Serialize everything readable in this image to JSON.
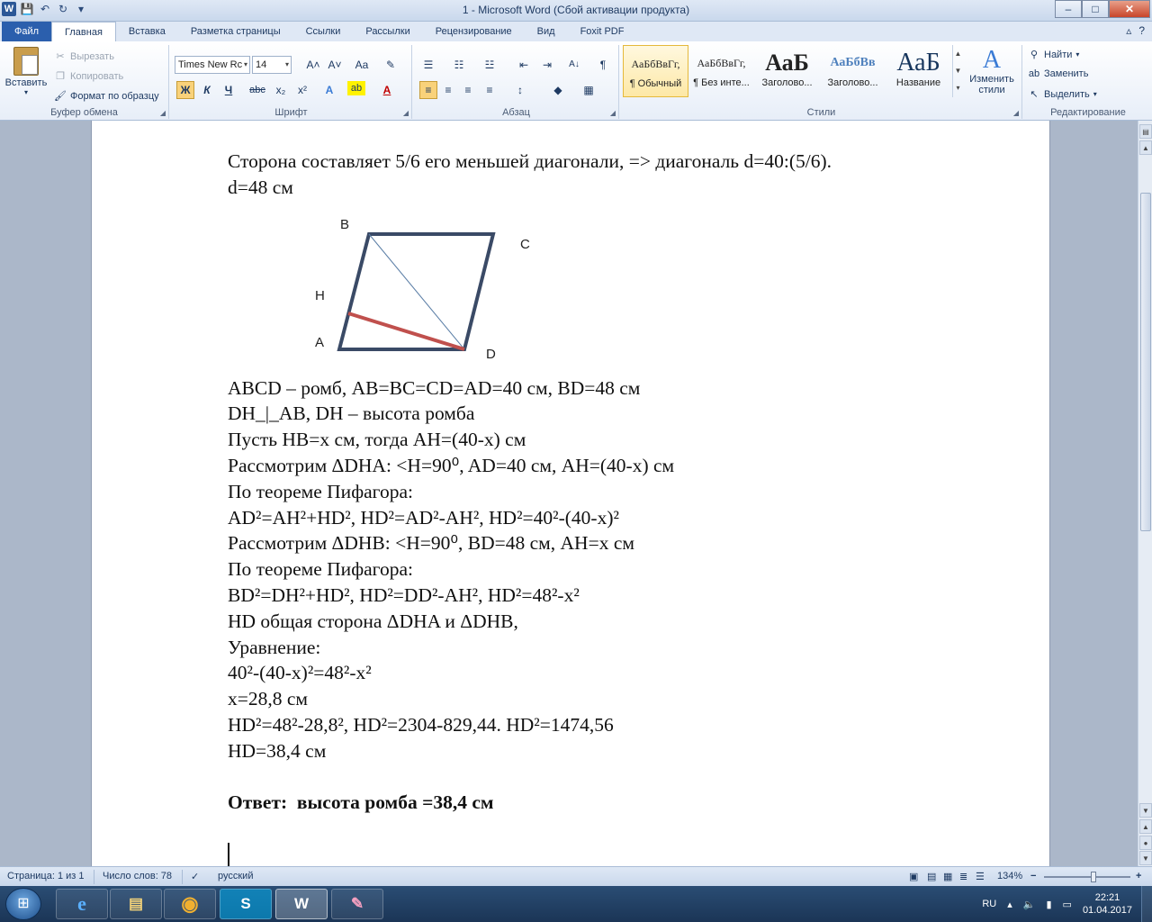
{
  "window": {
    "title": "1  -  Microsoft Word (Сбой активации продукта)",
    "app_icon_letter": "W",
    "minimize": "–",
    "maximize": "□",
    "close": "✕"
  },
  "quick_access": {
    "save": "💾",
    "undo": "↶",
    "redo": "↻",
    "customize": "▾"
  },
  "tabs": [
    "Файл",
    "Главная",
    "Вставка",
    "Разметка страницы",
    "Ссылки",
    "Рассылки",
    "Рецензирование",
    "Вид",
    "Foxit PDF"
  ],
  "tabs_right": {
    "collapse": "▵",
    "help": "?"
  },
  "ribbon": {
    "clipboard": {
      "label": "Буфер обмена",
      "paste": "Вставить",
      "cut": "Вырезать",
      "copy": "Копировать",
      "format_painter": "Формат по образцу"
    },
    "font": {
      "label": "Шрифт",
      "font_name": "Times New Rc",
      "font_size": "14",
      "grow": "A˄",
      "shrink": "A˅",
      "case": "Aa",
      "clear": "✎",
      "bold": "Ж",
      "italic": "К",
      "underline": "Ч",
      "strike": "abc",
      "subscript": "x₂",
      "superscript": "x²",
      "effects": "A",
      "highlight": "ab",
      "font_color": "A"
    },
    "paragraph": {
      "label": "Абзац",
      "bullets": "☰",
      "numbering": "☷",
      "multilevel": "☳",
      "decrease_indent": "⇤",
      "increase_indent": "⇥",
      "sort": "A↓",
      "pilcrow": "¶",
      "align_left": "≡",
      "align_center": "≡",
      "align_right": "≡",
      "justify": "≡",
      "line_spacing": "↕",
      "shading": "◆",
      "borders": "▦"
    },
    "styles": {
      "label": "Стили",
      "items": [
        {
          "sample": "АаБбВвГг,",
          "name": "¶ Обычный"
        },
        {
          "sample": "АаБбВвГг,",
          "name": "¶ Без инте..."
        },
        {
          "sample": "АаБ",
          "name": "Заголово..."
        },
        {
          "sample": "АаБбВв",
          "name": "Заголово..."
        },
        {
          "sample": "АаБ",
          "name": "Название"
        }
      ],
      "change_styles": "Изменить стили"
    },
    "editing": {
      "label": "Редактирование",
      "find": "Найти",
      "replace": "Заменить",
      "select": "Выделить"
    }
  },
  "document": {
    "lines_top": [
      "Сторона составляет  5/6 его меньшей диагонали, =>  диагональ d=40:(5/6).",
      "d=48 см"
    ],
    "figure_labels": {
      "b": "B",
      "c": "C",
      "h": "H",
      "a": "A",
      "d": "D"
    },
    "body": {
      "l1": "ABCD – ромб, AB=BC=CD=AD=40 см, BD=48 см",
      "l2": "DH_|_AB, DH – высота ромба",
      "l3": "Пусть HB=x см, тогда AH=(40-x) см",
      "l4": "Рассмотрим ΔDHA: <H=90⁰, AD=40 см, AH=(40-x) см",
      "l5": "По теореме Пифагора:",
      "l6": "AD²=AH²+HD², HD²=AD²-AH², HD²=40²-(40-x)²",
      "l7": "Рассмотрим ΔDHB: <H=90⁰, BD=48 см, AH=x см",
      "l8": "По теореме Пифагора:",
      "l9": "BD²=DH²+HD², HD²=DD²-AH², HD²=48²-x²",
      "l10": "HD общая сторона ΔDHA и ΔDHB,",
      "l11": "Уравнение:",
      "l12": "40²-(40-x)²=48²-x²",
      "l13": "x=28,8 см",
      "l14": "HD²=48²-28,8², HD²=2304-829,44. HD²=1474,56",
      "l15": "HD=38,4 см",
      "answer": "Ответ:  высота ромба =38,4 см"
    }
  },
  "statusbar": {
    "page": "Страница: 1 из 1",
    "words": "Число слов: 78",
    "language": "русский",
    "zoom": "134%",
    "zoom_out": "−",
    "zoom_in": "+"
  },
  "taskbar": {
    "start": "⊞",
    "apps": [
      {
        "name": "ie",
        "glyph": "e"
      },
      {
        "name": "explorer",
        "glyph": "▤"
      },
      {
        "name": "chrome",
        "glyph": "◉"
      },
      {
        "name": "skype",
        "glyph": "S"
      },
      {
        "name": "word",
        "glyph": "W"
      },
      {
        "name": "paint",
        "glyph": "✎"
      }
    ],
    "lang": "RU",
    "time": "22:21",
    "date": "01.04.2017"
  }
}
